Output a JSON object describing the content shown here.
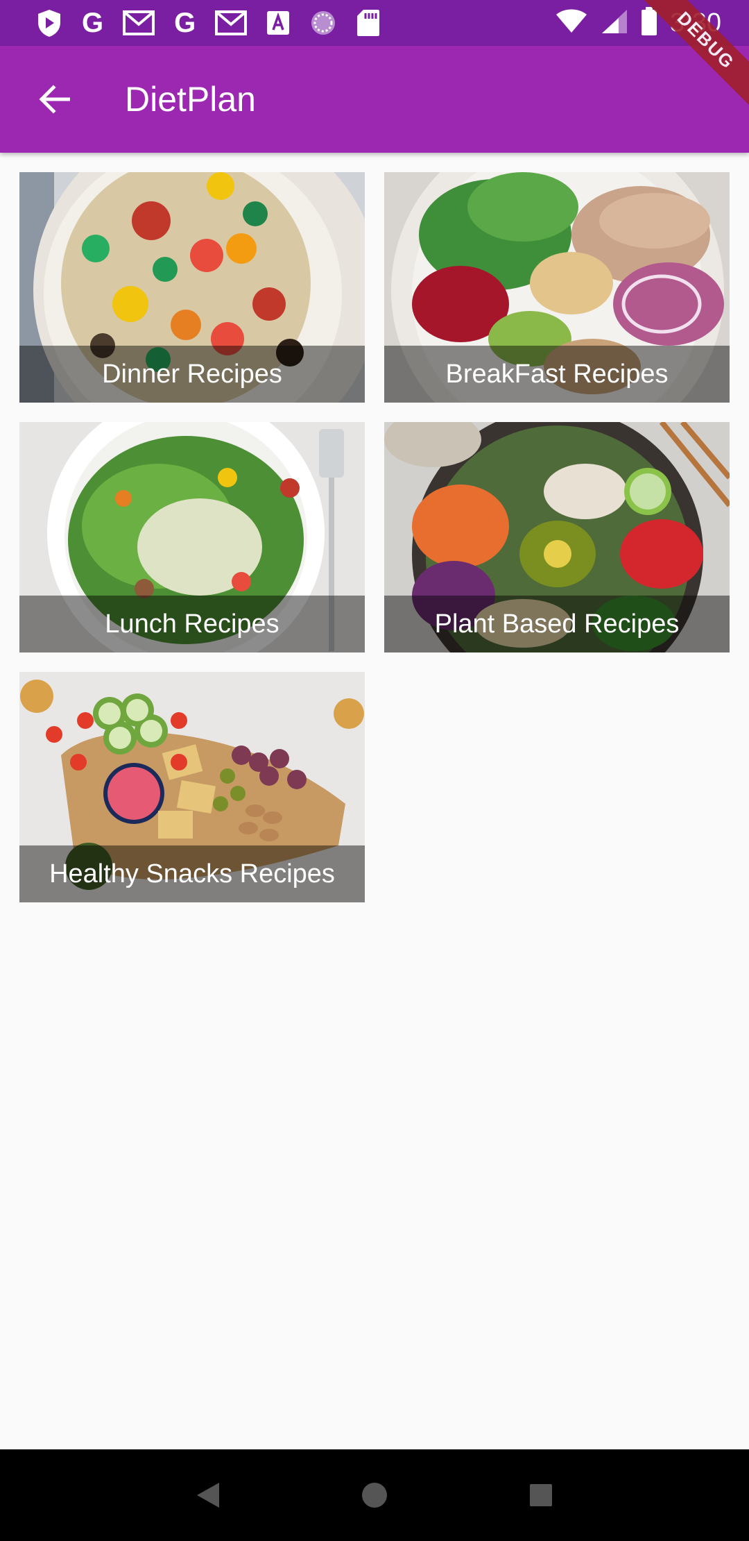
{
  "status_bar": {
    "time": "3:30",
    "left_icons": [
      "shield-icon",
      "google-icon",
      "gmail-icon",
      "google-icon",
      "gmail-icon",
      "font-download-icon",
      "loading-circle-icon",
      "sd-card-icon"
    ],
    "right_icons": [
      "wifi-icon",
      "signal-icon",
      "battery-icon"
    ],
    "google_letter": "G"
  },
  "debug_banner": "DEBUG",
  "app_bar": {
    "title": "DietPlan",
    "back_icon": "arrow-back-icon",
    "color": "#9c27b0",
    "status_color": "#7b1fa2"
  },
  "categories": [
    {
      "label": "Dinner Recipes"
    },
    {
      "label": "BreakFast Recipes"
    },
    {
      "label": "Lunch Recipes"
    },
    {
      "label": "Plant Based Recipes"
    },
    {
      "label": "Healthy Snacks Recipes"
    }
  ],
  "nav_bar": {
    "icons": [
      "back-triangle-icon",
      "home-circle-icon",
      "recents-square-icon"
    ]
  }
}
